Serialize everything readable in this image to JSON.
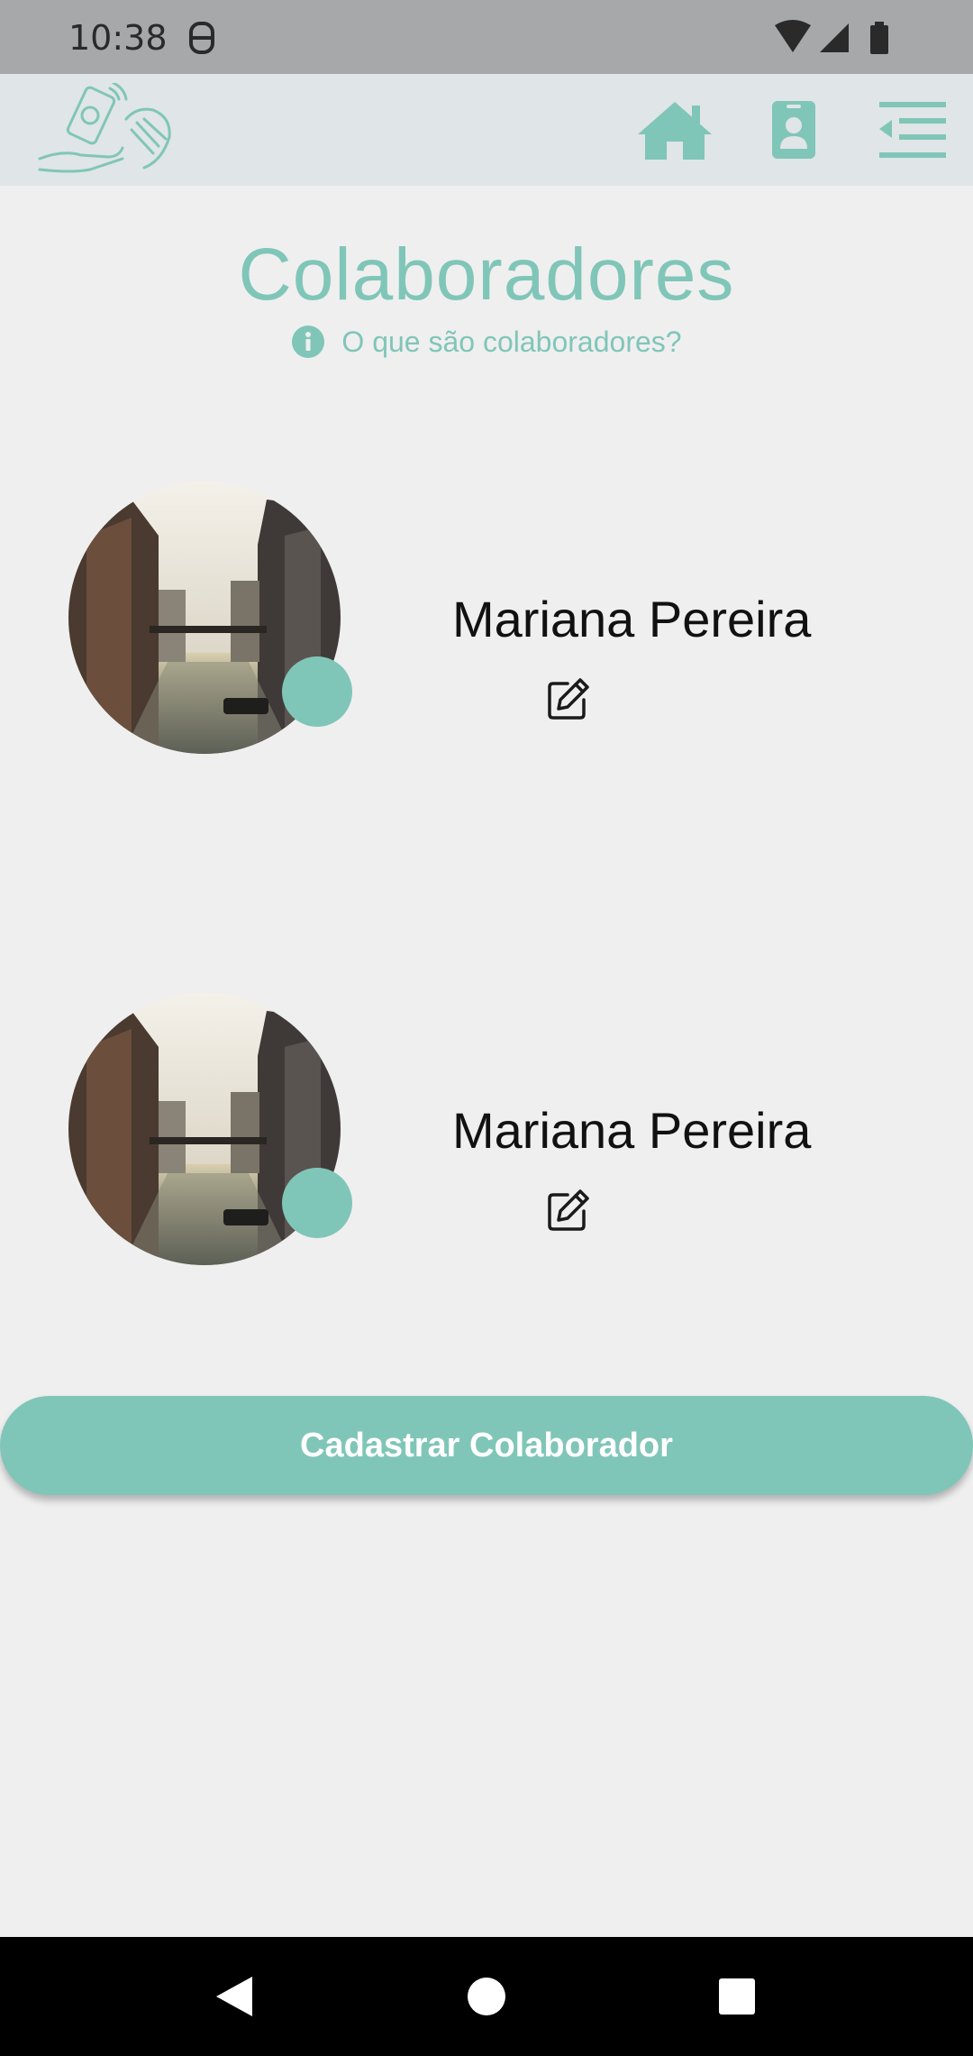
{
  "status_bar": {
    "time": "10:38"
  },
  "app_bar": {
    "icons": [
      "logo-hands-phone",
      "home-icon",
      "id-badge-icon",
      "menu-collapse-icon"
    ]
  },
  "page": {
    "title": "Colaboradores",
    "info_text": "O que são colaboradores?"
  },
  "collaborators": [
    {
      "name": "Mariana Pereira",
      "status_color": "#80c6b8"
    },
    {
      "name": "Mariana Pereira",
      "status_color": "#80c6b8"
    }
  ],
  "actions": {
    "register_label": "Cadastrar Colaborador"
  },
  "colors": {
    "accent": "#80c6b8",
    "background": "#efefef",
    "app_bar": "#e0e5e7",
    "status_bar": "#a6a8aa"
  }
}
